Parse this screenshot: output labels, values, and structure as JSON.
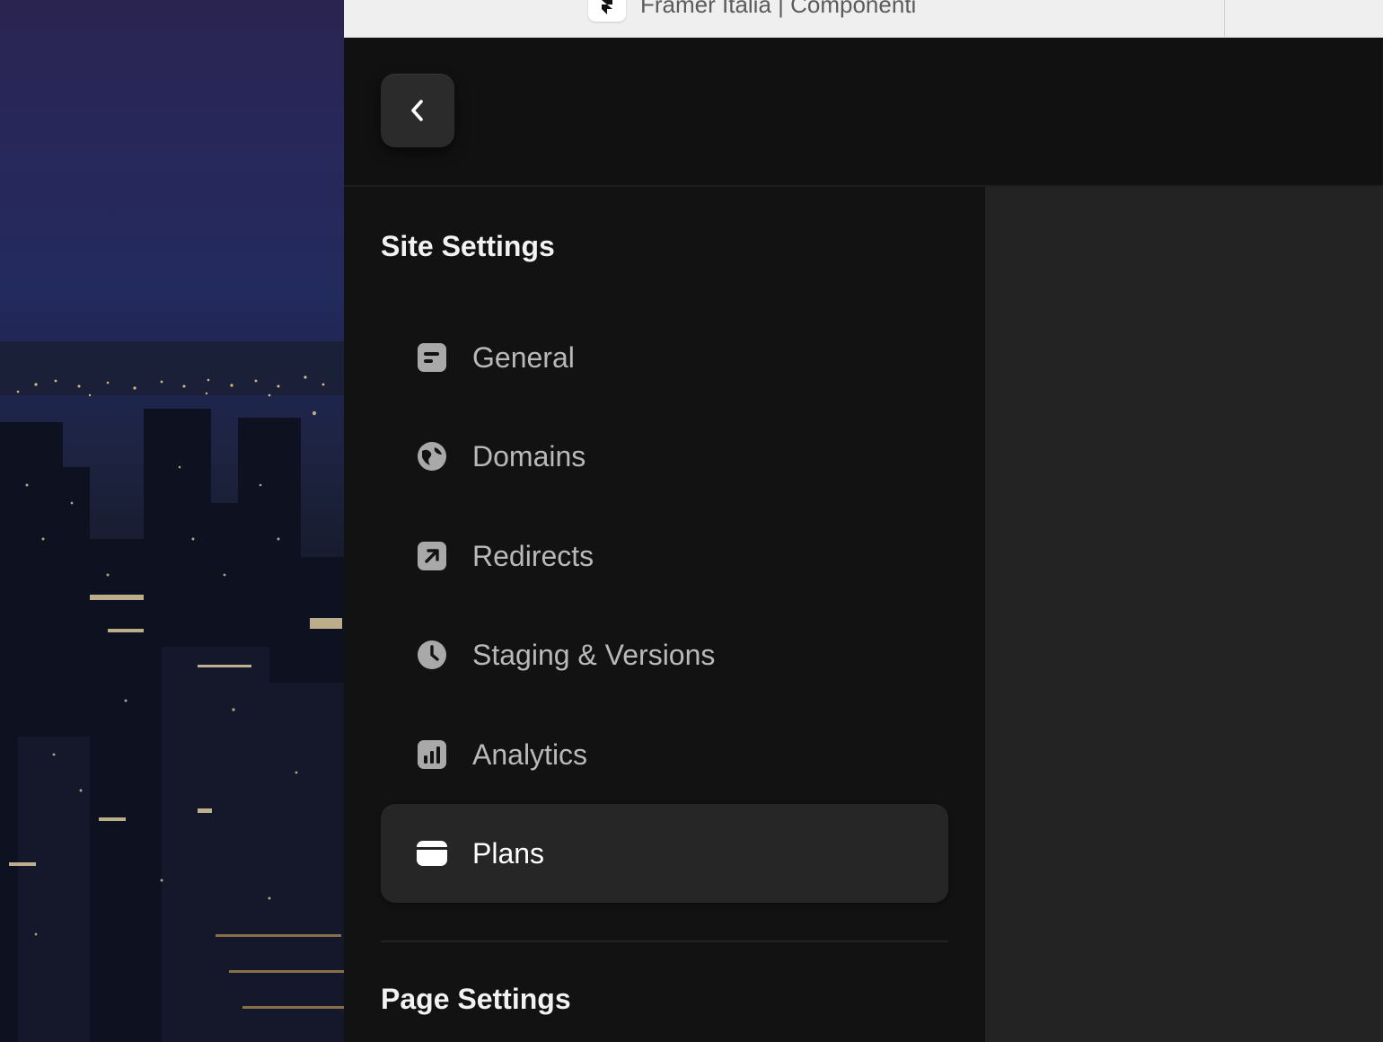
{
  "browser": {
    "tab_title": "Framer Italia | Componenti"
  },
  "colors": {
    "app_background": "#111111",
    "content_background": "#232323",
    "selected_item": "#262626",
    "text_primary": "#f2f2f2",
    "text_secondary": "#b9b9b9"
  },
  "header": {
    "back_icon": "chevron-left-icon"
  },
  "site_settings": {
    "title": "Site Settings",
    "items": [
      {
        "label": "General",
        "icon": "general-icon",
        "selected": false
      },
      {
        "label": "Domains",
        "icon": "globe-icon",
        "selected": false
      },
      {
        "label": "Redirects",
        "icon": "redirect-arrow-icon",
        "selected": false
      },
      {
        "label": "Staging & Versions",
        "icon": "clock-icon",
        "selected": false
      },
      {
        "label": "Analytics",
        "icon": "analytics-icon",
        "selected": false
      },
      {
        "label": "Plans",
        "icon": "card-icon",
        "selected": true
      }
    ]
  },
  "page_settings": {
    "title": "Page Settings"
  }
}
